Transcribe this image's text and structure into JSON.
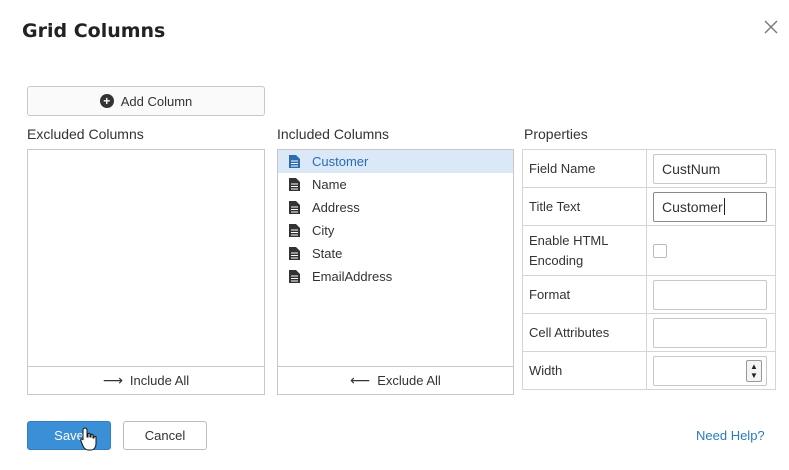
{
  "dialog": {
    "title": "Grid Columns",
    "close_icon": "close-icon"
  },
  "add_column": {
    "label": "Add Column",
    "icon": "plus-circle-icon"
  },
  "excluded": {
    "heading": "Excluded Columns",
    "items": [],
    "footer_label": "Include All",
    "footer_icon": "arrow-right-icon"
  },
  "included": {
    "heading": "Included Columns",
    "items": [
      {
        "label": "Customer",
        "selected": true
      },
      {
        "label": "Name",
        "selected": false
      },
      {
        "label": "Address",
        "selected": false
      },
      {
        "label": "City",
        "selected": false
      },
      {
        "label": "State",
        "selected": false
      },
      {
        "label": "EmailAddress",
        "selected": false
      }
    ],
    "footer_label": "Exclude All",
    "footer_icon": "arrow-left-icon"
  },
  "properties": {
    "heading": "Properties",
    "field_name": {
      "label": "Field Name",
      "value": "CustNum"
    },
    "title_text": {
      "label": "Title Text",
      "value": "Customer"
    },
    "enable_html": {
      "label": "Enable HTML Encoding",
      "checked": false
    },
    "format": {
      "label": "Format",
      "value": ""
    },
    "cell_attributes": {
      "label": "Cell Attributes",
      "value": ""
    },
    "width": {
      "label": "Width",
      "value": ""
    }
  },
  "footer": {
    "save_label": "Save",
    "cancel_label": "Cancel",
    "help_label": "Need Help?"
  },
  "colors": {
    "accent": "#3a8fd6",
    "selection_bg": "#dbe8f7",
    "link": "#2a7ac0"
  }
}
